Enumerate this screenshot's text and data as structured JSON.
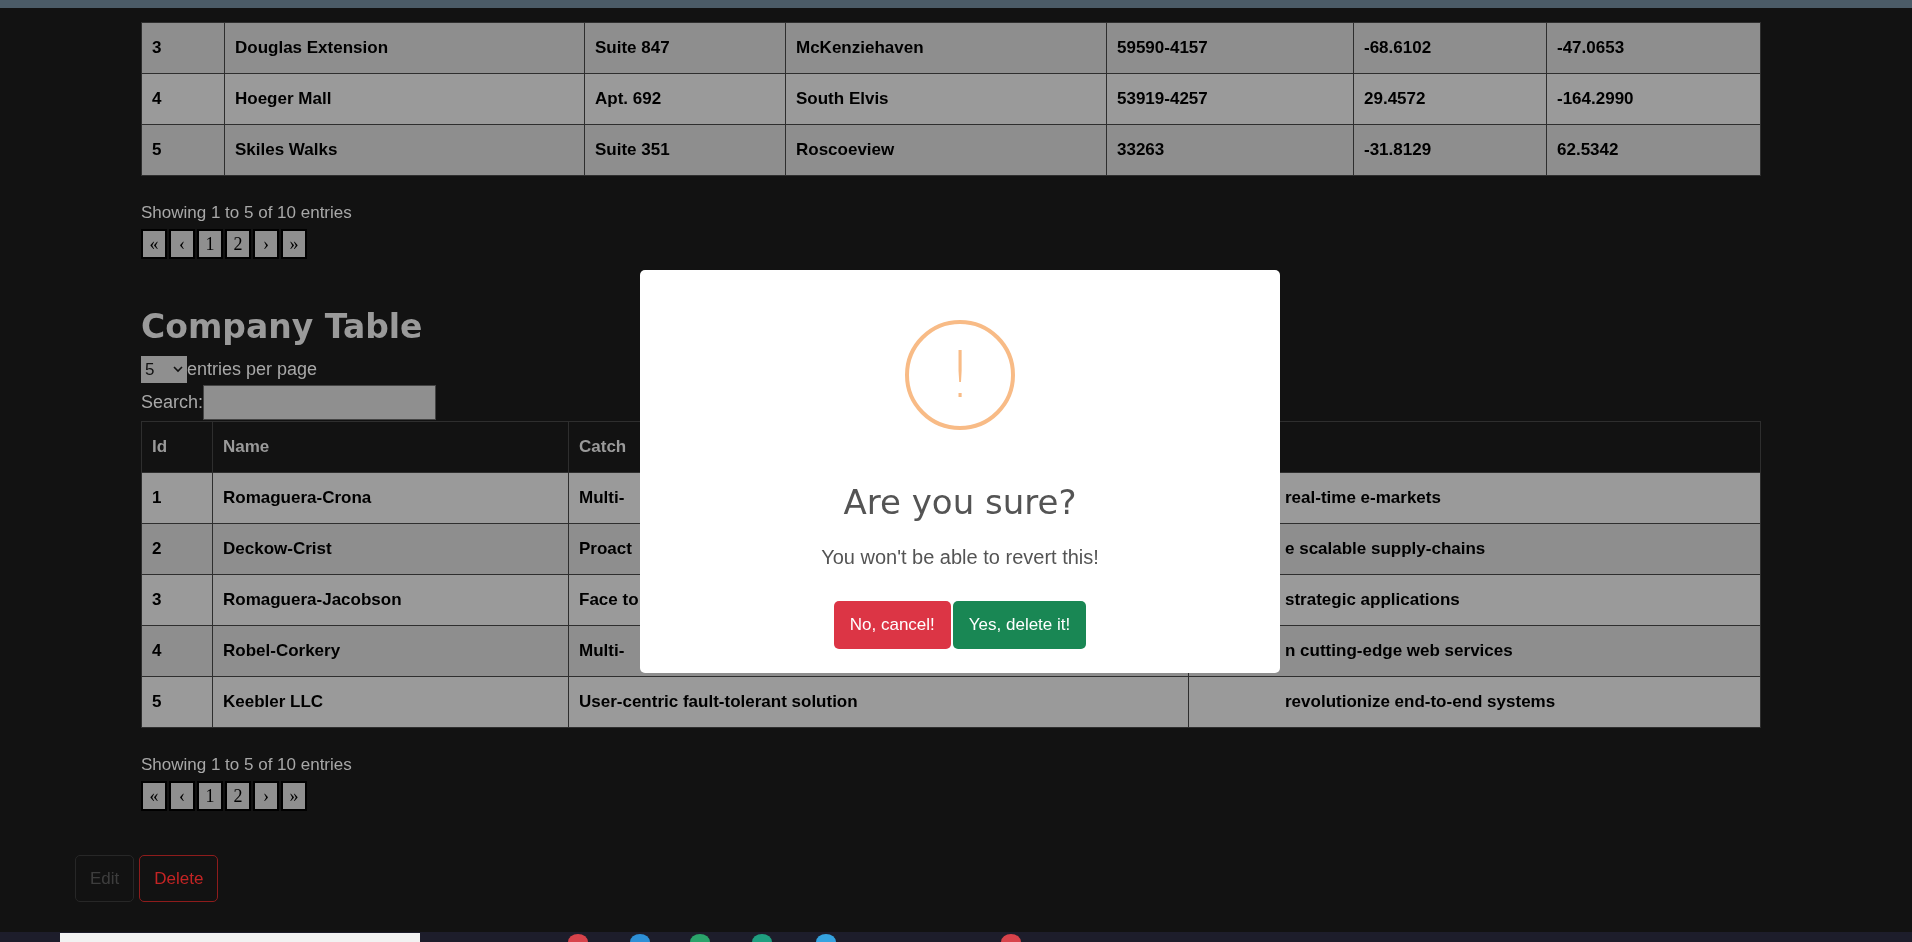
{
  "address_table": {
    "rows": [
      [
        "3",
        "Douglas Extension",
        "Suite 847",
        "McKenziehaven",
        "59590-4157",
        "-68.6102",
        "-47.0653"
      ],
      [
        "4",
        "Hoeger Mall",
        "Apt. 692",
        "South Elvis",
        "53919-4257",
        "29.4572",
        "-164.2990"
      ],
      [
        "5",
        "Skiles Walks",
        "Suite 351",
        "Roscoeview",
        "33263",
        "-31.8129",
        "62.5342"
      ]
    ],
    "info": "Showing 1 to 5 of 10 entries",
    "pagination": [
      "«",
      "‹",
      "1",
      "2",
      "›",
      "»"
    ]
  },
  "company_table": {
    "title": "Company Table",
    "page_size": {
      "value": "5",
      "label": "entries per page"
    },
    "search": {
      "label": "Search:"
    },
    "columns": [
      "Id",
      "Name",
      "Catch"
    ],
    "rows": [
      {
        "id": "1",
        "name": "Romaguera-Crona",
        "catch_phrase": "Multi-",
        "column_4": "real-time e-markets"
      },
      {
        "id": "2",
        "name": "Deckow-Crist",
        "catch_phrase": "Proact",
        "column_4": "e scalable supply-chains"
      },
      {
        "id": "3",
        "name": "Romaguera-Jacobson",
        "catch_phrase": "Face to",
        "column_4": "strategic applications"
      },
      {
        "id": "4",
        "name": "Robel-Corkery",
        "catch_phrase": "Multi-",
        "column_4": "n cutting-edge web services"
      },
      {
        "id": "5",
        "name": "Keebler LLC",
        "catch_phrase": "User-centric fault-tolerant solution",
        "column_4": "revolutionize end-to-end systems"
      }
    ],
    "info": "Showing 1 to 5 of 10 entries",
    "pagination": [
      "«",
      "‹",
      "1",
      "2",
      "›",
      "»"
    ]
  },
  "dialog": {
    "title": "Are you sure?",
    "text": "You won't be able to revert this!",
    "icon": "!",
    "buttons": [
      {
        "label": "No, cancel!",
        "kind": "cancel"
      },
      {
        "label": "Yes, delete it!",
        "kind": "confirm"
      }
    ]
  },
  "buttons": [
    {
      "label": "Edit",
      "kind": "secondary",
      "disabled": true
    },
    {
      "label": "Delete",
      "kind": "danger",
      "disabled": false
    }
  ]
}
